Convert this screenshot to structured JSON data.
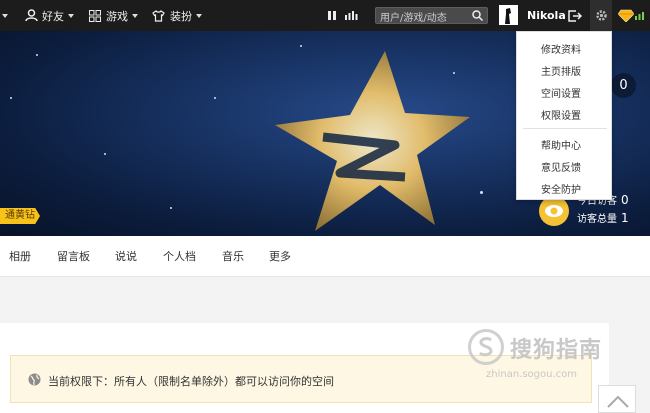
{
  "topbar": {
    "friends_label": "好友",
    "games_label": "游戏",
    "dress_label": "装扮",
    "search_placeholder": "用户/游戏/动态",
    "username": "Nikola"
  },
  "banner": {
    "yellow_diamond_label": "通黄钻",
    "right_count": "0",
    "today_visitors_label": "今日访客",
    "today_visitors_value": "0",
    "total_visitors_label": "访客总量",
    "total_visitors_value": "1"
  },
  "settings_menu": {
    "items": [
      "修改资料",
      "主页排版",
      "空间设置",
      "权限设置",
      "帮助中心",
      "意见反馈",
      "安全防护"
    ]
  },
  "nav": {
    "items": [
      "相册",
      "留言板",
      "说说",
      "个人档",
      "音乐",
      "更多"
    ]
  },
  "notice": {
    "text": "当前权限下：所有人（限制名单除外）都可以访问你的空间"
  },
  "watermark": {
    "brand": "搜狗指南",
    "url": "zhinan.sogou.com"
  },
  "colors": {
    "topbar": "#1c1c1c",
    "accent_yellow": "#f7c21a",
    "notice_bg": "#fdf7e3"
  }
}
